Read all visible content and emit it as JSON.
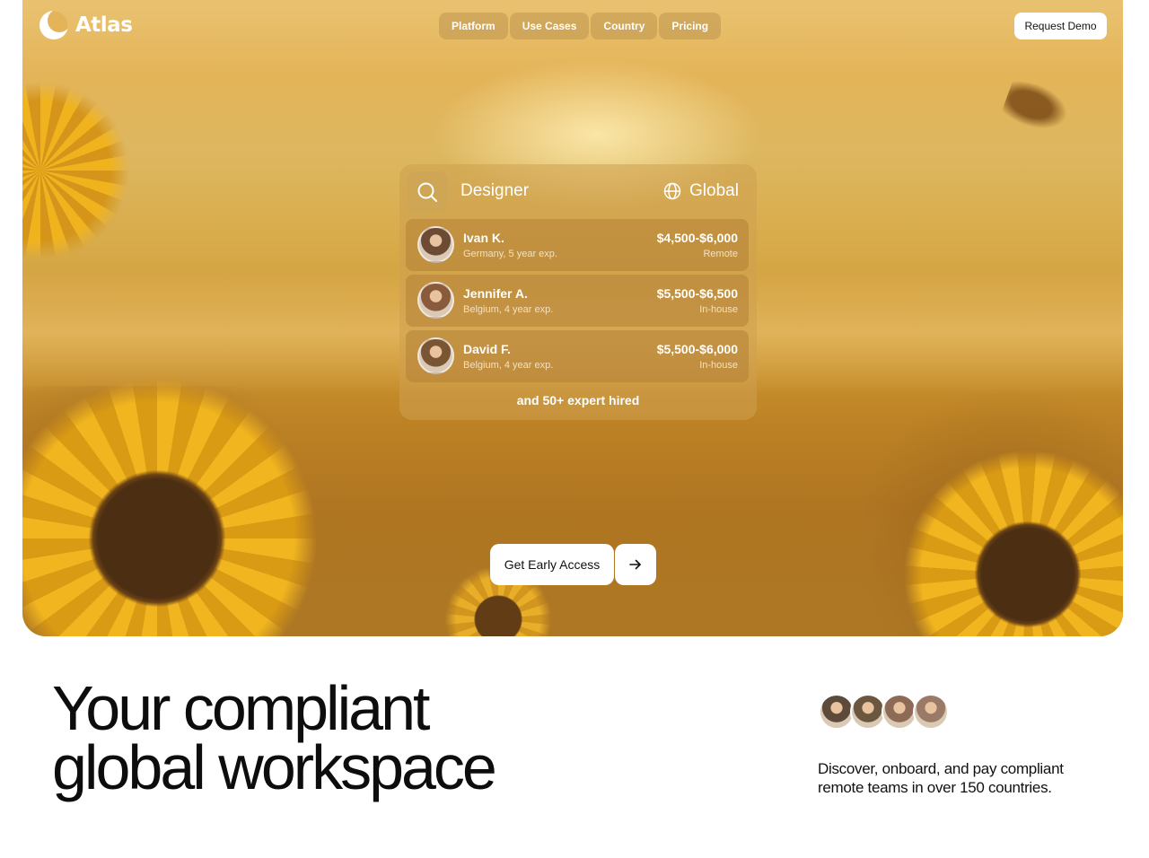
{
  "brand": {
    "name": "Atlas"
  },
  "nav": {
    "items": [
      "Platform",
      "Use Cases",
      "Country",
      "Pricing"
    ]
  },
  "header": {
    "demo_label": "Request Demo"
  },
  "search": {
    "query": "Designer",
    "region": "Global"
  },
  "candidates": [
    {
      "name": "Ivan K.",
      "meta": "Germany, 5 year exp.",
      "salary": "$4,500-$6,000",
      "mode": "Remote",
      "avatar_color": "#6d4a33"
    },
    {
      "name": "Jennifer A.",
      "meta": "Belgium, 4 year exp.",
      "salary": "$5,500-$6,500",
      "mode": "In-house",
      "avatar_color": "#8a5a3c"
    },
    {
      "name": "David F.",
      "meta": "Belgium, 4 year exp.",
      "salary": "$5,500-$6,000",
      "mode": "In-house",
      "avatar_color": "#7a5533"
    }
  ],
  "hired_note": "and 50+ expert hired",
  "cta": {
    "label": "Get Early Access",
    "arrow_icon": "arrow-right-icon"
  },
  "headline": {
    "line1": "Your compliant",
    "line2": "global workspace"
  },
  "team_avatars": [
    "#5e4a3a",
    "#6b5640",
    "#8c6a55",
    "#9a7a66"
  ],
  "description": "Discover, onboard, and pay compliant remote teams in over 150 countries.",
  "colors": {
    "accent": "#e3b45a",
    "hero_warm": "#d8ab4a",
    "text": "#111111"
  }
}
